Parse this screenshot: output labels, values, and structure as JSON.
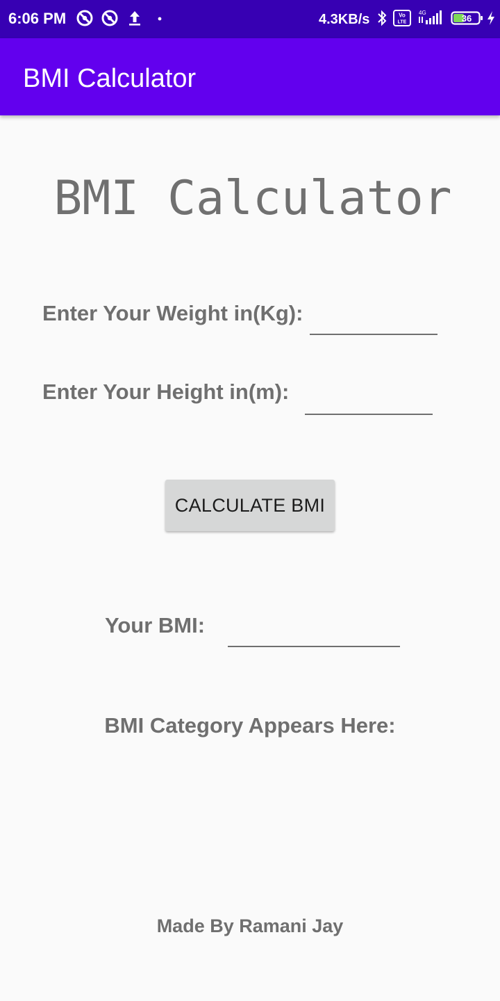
{
  "status_bar": {
    "time": "6:06 PM",
    "network_speed": "4.3KB/s",
    "battery_level": "36",
    "network_type": "4G",
    "volte_label": "Vo LTE",
    "icons": [
      "sync-icon",
      "sync-icon",
      "upload-icon",
      "dot-icon",
      "bluetooth-icon",
      "volte-icon",
      "signal-icon",
      "battery-icon",
      "charging-icon"
    ]
  },
  "app_bar": {
    "title": "BMI Calculator",
    "color": "#6200ee"
  },
  "main": {
    "heading": "BMI Calculator",
    "weight_label": "Enter Your Weight in(Kg):",
    "weight_value": "",
    "height_label": "Enter Your Height in(m):",
    "height_value": "",
    "calculate_button": "CALCULATE BMI",
    "bmi_label": "Your BMI:",
    "bmi_value": "",
    "category_text": "BMI Category Appears Here:",
    "footer": "Made By Ramani Jay"
  },
  "colors": {
    "status_bar": "#3700b3",
    "app_bar": "#6200ee",
    "background": "#fafafa",
    "text_gray": "#6f6f6f",
    "button_bg": "#d6d7d7"
  }
}
